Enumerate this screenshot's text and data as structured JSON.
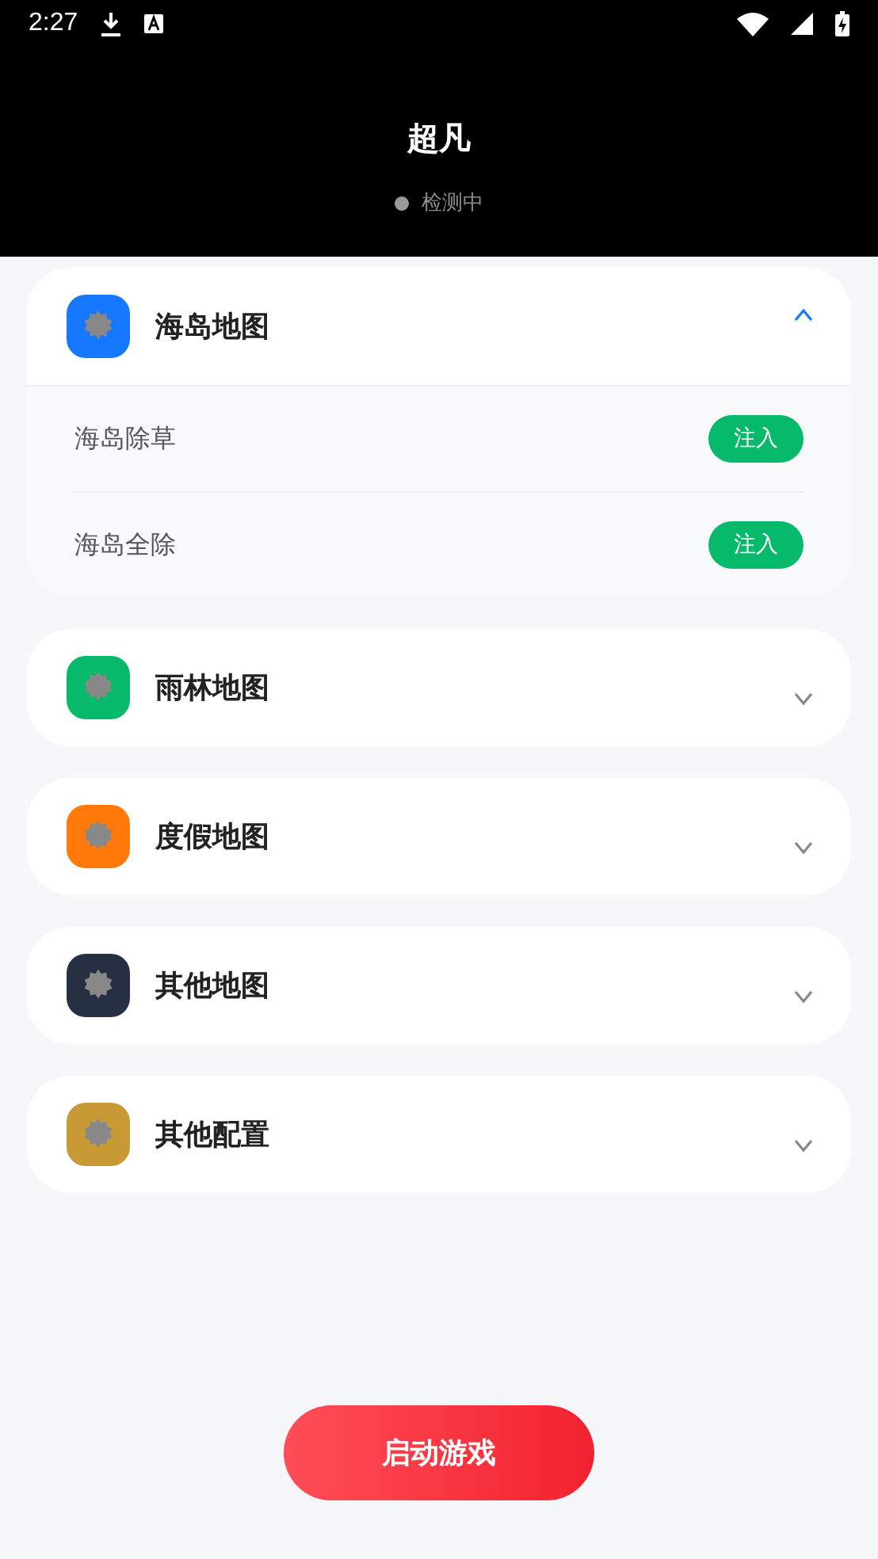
{
  "status_bar": {
    "time": "2:27"
  },
  "header": {
    "title": "超凡",
    "status": "检测中"
  },
  "sections": [
    {
      "title": "海岛地图",
      "color": "#1677ff",
      "expanded": true,
      "items": [
        {
          "label": "海岛除草",
          "action": "注入"
        },
        {
          "label": "海岛全除",
          "action": "注入"
        }
      ]
    },
    {
      "title": "雨林地图",
      "color": "#07b96b",
      "expanded": false
    },
    {
      "title": "度假地图",
      "color": "#ff7a0a",
      "expanded": false
    },
    {
      "title": "其他地图",
      "color": "#263042",
      "expanded": false
    },
    {
      "title": "其他配置",
      "color": "#c89a35",
      "expanded": false
    }
  ],
  "launch_button": "启动游戏"
}
